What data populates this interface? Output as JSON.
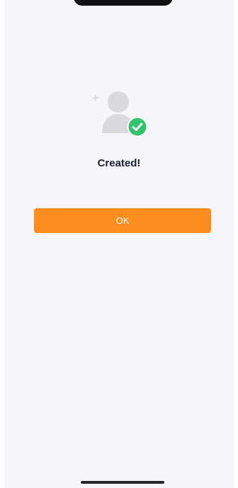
{
  "result": {
    "title": "Created!",
    "ok_label": "OK",
    "icons": {
      "sparkle": "sparkle-icon",
      "avatar": "user-avatar-icon",
      "badge": "check-circle-icon"
    }
  },
  "colors": {
    "background": "#f5f5fa",
    "accent": "#fb8c1e",
    "success": "#34c26e",
    "avatar": "#d8dae0",
    "title": "#1c2030",
    "button_text": "#ffffff"
  }
}
